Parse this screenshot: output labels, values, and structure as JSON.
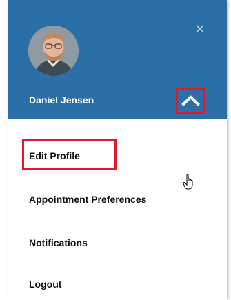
{
  "user": {
    "name": "Daniel Jensen"
  },
  "header": {
    "close_icon": "close-icon",
    "collapse_icon": "chevron-up-icon",
    "accent_color": "#2a6fa8",
    "highlight_color": "#e0192c"
  },
  "menu": {
    "items": [
      {
        "label": "Edit Profile"
      },
      {
        "label": "Appointment Preferences"
      },
      {
        "label": "Notifications"
      },
      {
        "label": "Logout"
      }
    ]
  },
  "cursor": "hand-pointer-icon"
}
